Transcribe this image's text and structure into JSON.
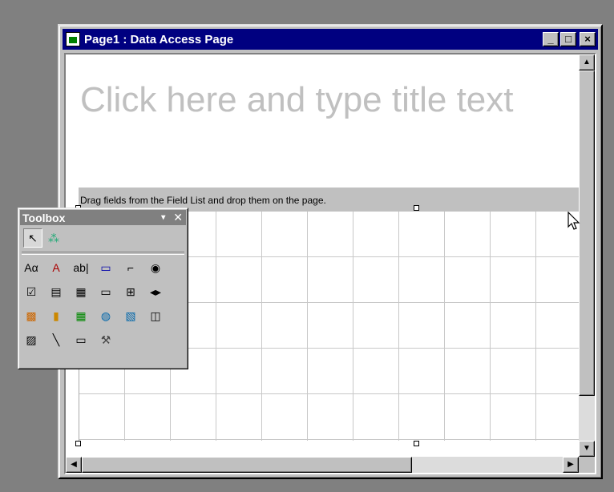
{
  "window": {
    "title": "Page1 : Data Access Page",
    "min_glyph": "_",
    "max_glyph": "□",
    "close_glyph": "×"
  },
  "page": {
    "title_placeholder": "Click here and type title text",
    "section_hint": "Drag fields from the Field List and drop them on the page."
  },
  "toolbox": {
    "title": "Toolbox",
    "menu_glyph": "▾",
    "close_glyph": "✕",
    "tools": [
      {
        "name": "select-objects",
        "glyph": "↖"
      },
      {
        "name": "control-wizards",
        "glyph": "⁂"
      },
      {
        "name": "label",
        "glyph": "Aα"
      },
      {
        "name": "bound-html",
        "glyph": "A"
      },
      {
        "name": "text-box",
        "glyph": "ab|"
      },
      {
        "name": "scrolling-text",
        "glyph": "▭"
      },
      {
        "name": "expand",
        "glyph": "⌐"
      },
      {
        "name": "option-button",
        "glyph": "◉"
      },
      {
        "name": "check-box",
        "glyph": "☑"
      },
      {
        "name": "dropdown-list",
        "glyph": "▤"
      },
      {
        "name": "list-box",
        "glyph": "▦"
      },
      {
        "name": "command-button",
        "glyph": "▭"
      },
      {
        "name": "expand-control",
        "glyph": "⊞"
      },
      {
        "name": "record-navigation",
        "glyph": "◂▸"
      },
      {
        "name": "office-pivottable",
        "glyph": "▩"
      },
      {
        "name": "office-chart",
        "glyph": "▮"
      },
      {
        "name": "office-spreadsheet",
        "glyph": "▦"
      },
      {
        "name": "hyperlink",
        "glyph": "◍"
      },
      {
        "name": "image-hyperlink",
        "glyph": "▧"
      },
      {
        "name": "movie",
        "glyph": "◫"
      },
      {
        "name": "image",
        "glyph": "▨"
      },
      {
        "name": "line",
        "glyph": "╲"
      },
      {
        "name": "rectangle",
        "glyph": "▭"
      },
      {
        "name": "more-controls",
        "glyph": "⚒"
      }
    ]
  },
  "scrollbars": {
    "up_glyph": "▲",
    "down_glyph": "▼",
    "left_glyph": "◀",
    "right_glyph": "▶"
  }
}
